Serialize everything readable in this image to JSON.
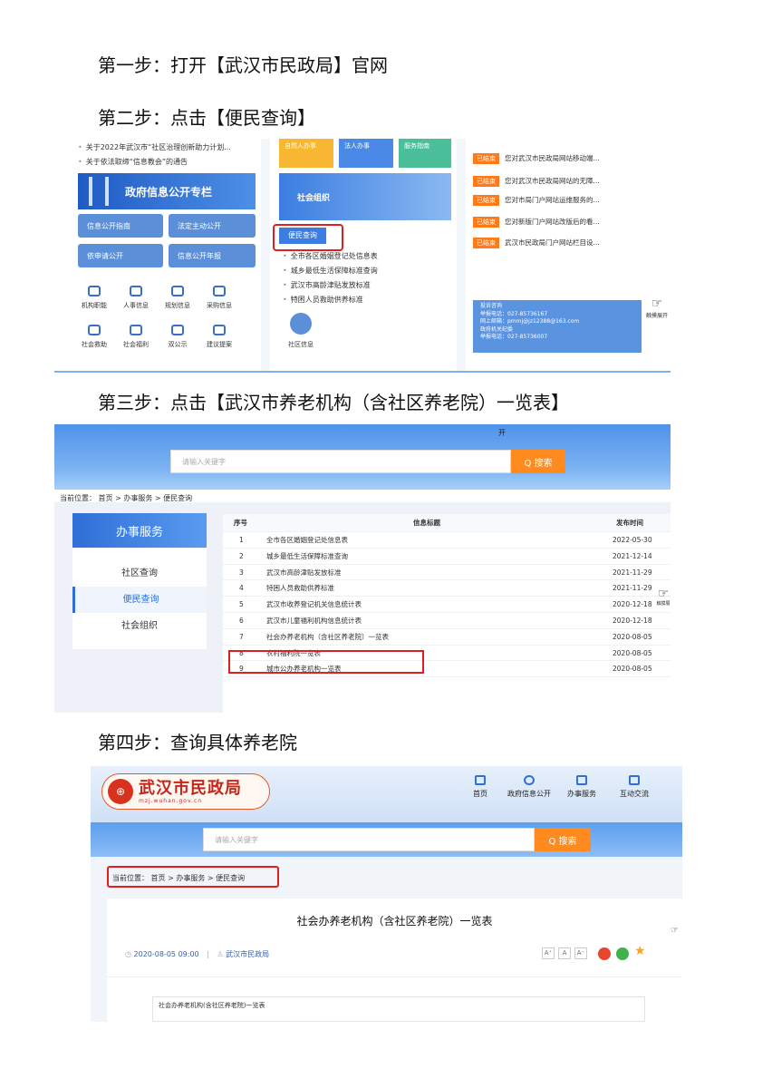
{
  "steps": {
    "s1": "第一步：打开【武汉市民政局】官网",
    "s2": "第二步：点击【便民查询】",
    "s3": "第三步：点击【武汉市养老机构（含社区养老院）一览表】",
    "s4": "第四步：查询具体养老院"
  },
  "shot1": {
    "news": [
      "关于2022年武汉市“社区治理创新助力计划...",
      "关于依法取缔“信息教会”的通告"
    ],
    "banner_title": "政府信息公开专栏",
    "gov_buttons": [
      "信息公开指南",
      "法定主动公开",
      "依申请公开",
      "信息公开年报"
    ],
    "icon_row1": [
      "机构职能",
      "人事信息",
      "规划信息",
      "采购信息"
    ],
    "icon_row2": [
      "社会救助",
      "社会福利",
      "双公示",
      "建议提案"
    ],
    "service_tabs": [
      "自然人办事",
      "法人办事",
      "服务指南"
    ],
    "social_org": "社会组织",
    "convenience_query": "便民查询",
    "query_links": [
      "全市各区婚姻登记处信息表",
      "城乡最低生活保障标准查询",
      "武汉市高龄津贴发放标准",
      "特困人员救助供养标准"
    ],
    "community_info": "社区信息",
    "notice_tag": "已结束",
    "notices": [
      "您对武汉市民政局网站移动端...",
      "您对武汉市民政局网站的无障...",
      "您对市局门户网站运维服务的...",
      "您对新版门户网站改版后的看...",
      "武汉市民政局门户网站栏目设..."
    ],
    "contact_title1": "投诉咨询",
    "contact_line1": "举报电话：027-85736167",
    "contact_line2": "网上邮箱：pmmj@jz12388@163.com",
    "contact_title2": "政府机关纪委",
    "contact_line3": "举报电话：027-85736007",
    "expand_label": "触摸展开"
  },
  "shot2": {
    "banner_partial": "开",
    "search_placeholder": "请输入关键字",
    "search_button": "Q 搜索",
    "breadcrumb": "当前位置： 首页 > 办事服务 > 便民查询",
    "sidebar_title": "办事服务",
    "sidebar_items": [
      "社区查询",
      "便民查询",
      "社会组织"
    ],
    "columns": [
      "序号",
      "信息标题",
      "发布时间"
    ],
    "rows": [
      {
        "no": "1",
        "title": "全市各区婚姻登记处信息表",
        "date": "2022-05-30"
      },
      {
        "no": "2",
        "title": "城乡最低生活保障标准查询",
        "date": "2021-12-14"
      },
      {
        "no": "3",
        "title": "武汉市高龄津贴发放标准",
        "date": "2021-11-29"
      },
      {
        "no": "4",
        "title": "特困人员救助供养标准",
        "date": "2021-11-29"
      },
      {
        "no": "5",
        "title": "武汉市收养登记机关信息统计表",
        "date": "2020-12-18"
      },
      {
        "no": "6",
        "title": "武汉市儿童福利机构信息统计表",
        "date": "2020-12-18"
      },
      {
        "no": "7",
        "title": "社会办养老机构（含社区养老院）一览表",
        "date": "2020-08-05"
      },
      {
        "no": "8",
        "title": "农村福利院一览表",
        "date": "2020-08-05"
      },
      {
        "no": "9",
        "title": "城市公办养老机构一览表",
        "date": "2020-08-05"
      }
    ],
    "touch_label": "触摸展"
  },
  "shot3": {
    "logo_text": "武汉市民政局",
    "logo_sub": "mzj.wuhan.gov.cn",
    "nav": [
      "首页",
      "政府信息公开",
      "办事服务",
      "互动交流"
    ],
    "search_placeholder": "请输入关键字",
    "search_button": "Q 搜索",
    "breadcrumb": "当前位置： 首页 > 办事服务 > 便民查询",
    "article_title": "社会办养老机构（含社区养老院）一览表",
    "publish_time": "2020-08-05 09:00",
    "source": "武汉市民政局",
    "font_sizes": [
      "A⁺",
      "A",
      "A⁻"
    ],
    "attachment": "社会办养老机构(含社区养老院)一览表"
  },
  "colors": {
    "accent": "#2f6fd6",
    "highlight": "#e02020",
    "orange": "#ff8a1e"
  }
}
